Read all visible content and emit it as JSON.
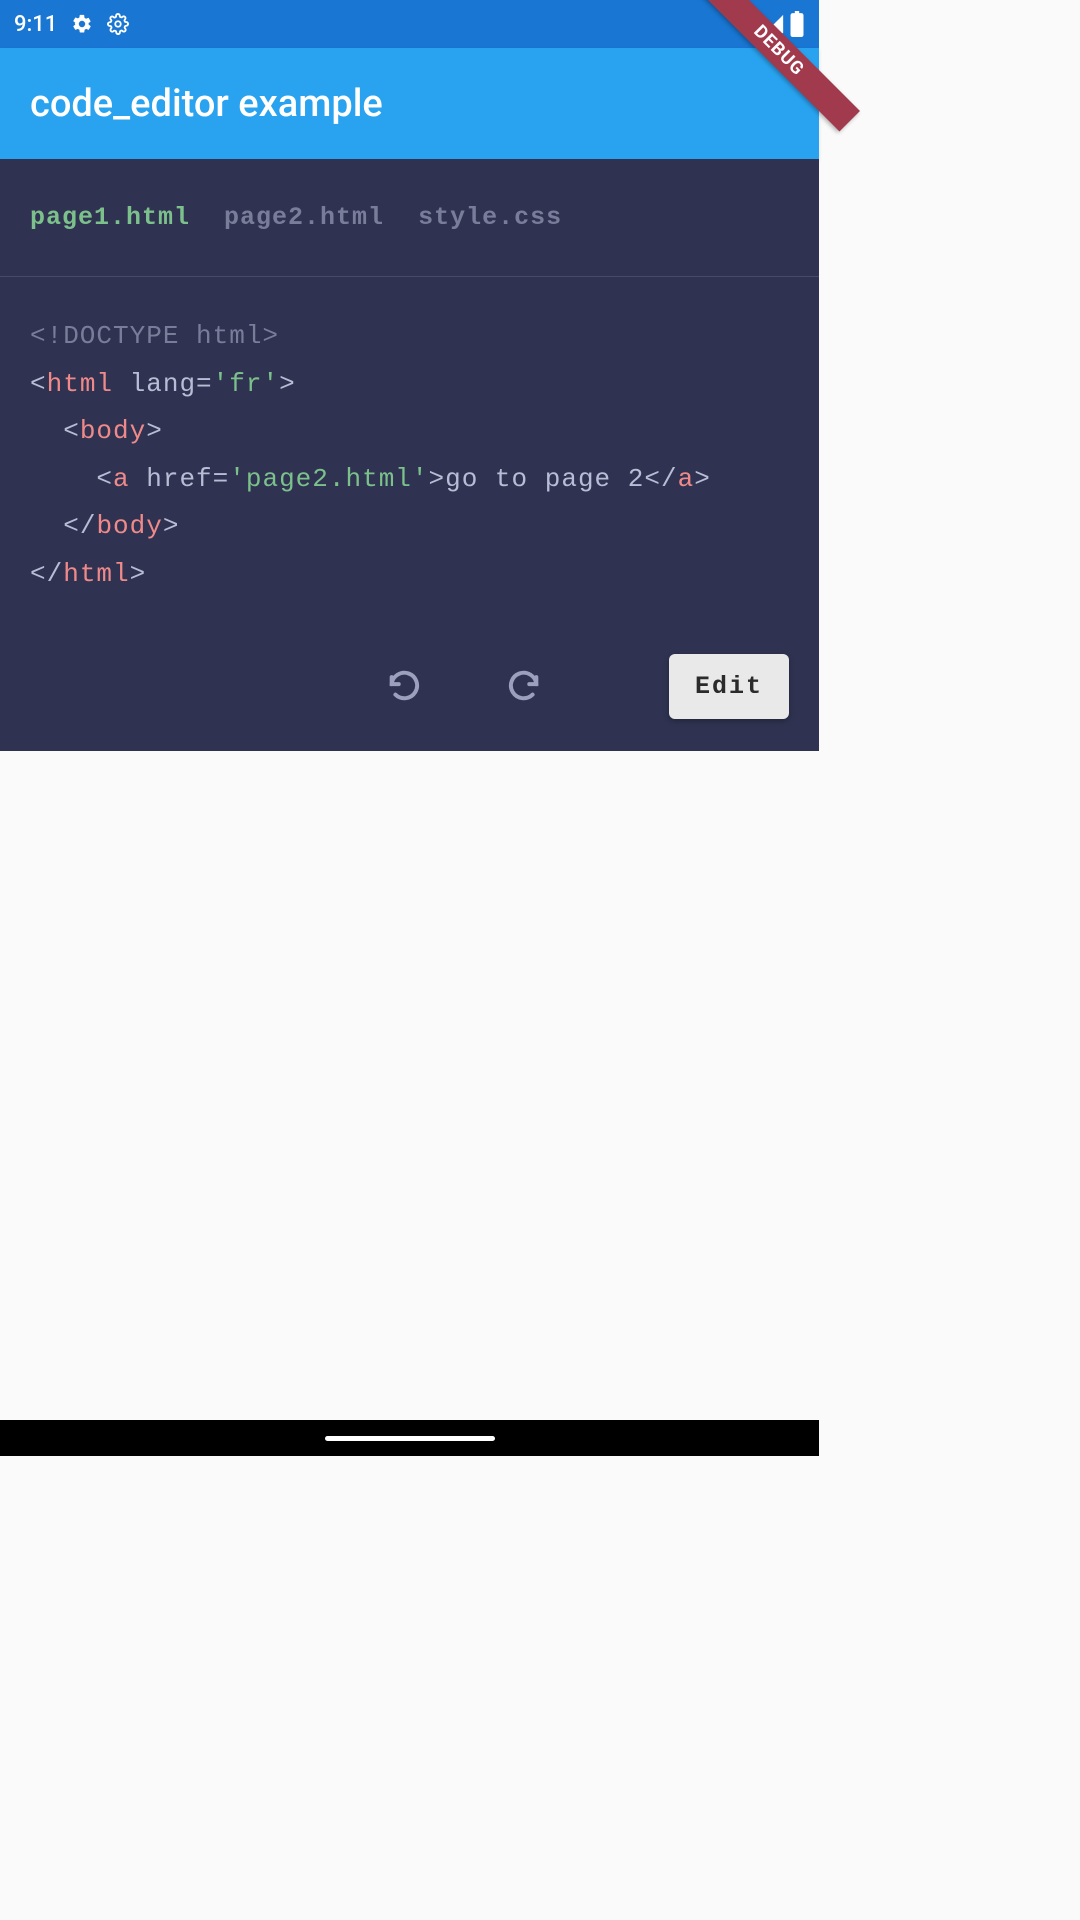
{
  "status": {
    "time": "9:11"
  },
  "app": {
    "title": "code_editor example"
  },
  "debug_banner": "DEBUG",
  "tabs": [
    {
      "label": "page1.html",
      "active": true
    },
    {
      "label": "page2.html",
      "active": false
    },
    {
      "label": "style.css",
      "active": false
    }
  ],
  "code": {
    "line1_doctype": "<!DOCTYPE html>",
    "line2": {
      "open": "<",
      "tag": "html",
      "space": " ",
      "attr": "lang=",
      "q1": "'",
      "str": "fr",
      "q2": "'",
      "close": ">"
    },
    "line3": {
      "indent": "  ",
      "open": "<",
      "tag": "body",
      "close": ">"
    },
    "line4": {
      "indent": "    ",
      "open": "<",
      "tag": "a",
      "space": " ",
      "attr": "href=",
      "q1": "'",
      "str": "page2.html",
      "q2": "'",
      "close": ">",
      "text": "go to page 2",
      "copen": "</",
      "ctag": "a",
      "cclose": ">"
    },
    "line5": {
      "indent": "  ",
      "open": "</",
      "tag": "body",
      "close": ">"
    },
    "line6": {
      "open": "</",
      "tag": "html",
      "close": ">"
    }
  },
  "actions": {
    "edit_label": "Edit"
  }
}
